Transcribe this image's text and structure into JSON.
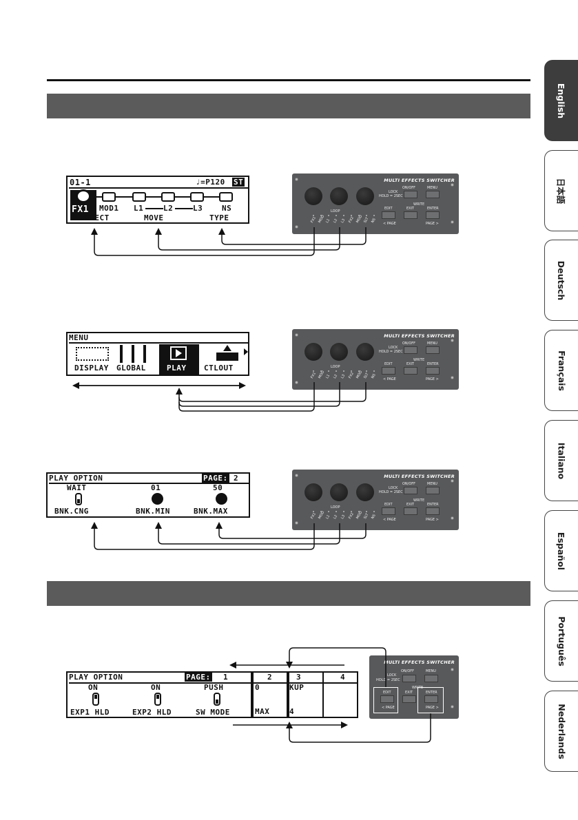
{
  "languages": [
    {
      "label": "English",
      "active": true
    },
    {
      "label": "日本語",
      "active": false
    },
    {
      "label": "Deutsch",
      "active": false
    },
    {
      "label": "Français",
      "active": false
    },
    {
      "label": "Italiano",
      "active": false
    },
    {
      "label": "Español",
      "active": false
    },
    {
      "label": "Português",
      "active": false
    },
    {
      "label": "Nederlands",
      "active": false
    }
  ],
  "panel": {
    "title": "MULTI EFFECTS SWITCHER",
    "on_off": "ON/OFF",
    "menu": "MENU",
    "lock": "LOCK",
    "hold_2sec": "HOLD = 2SEC",
    "write": "WRITE",
    "loop": "LOOP",
    "edit": "EDIT",
    "exit": "EXIT",
    "enter": "ENTER",
    "page_prev": "< PAGE",
    "page_next": "PAGE >",
    "knob_labels": [
      "FX1",
      "MOD",
      "L1",
      "L2",
      "L3",
      "FX2",
      "MOD",
      "SLT",
      "NS"
    ]
  },
  "screen1": {
    "patch": "01-1",
    "tempo": "♩=P120",
    "st": "ST",
    "blocks": [
      "FX1",
      "MOD1",
      "L1",
      "L2",
      "L3",
      "NS"
    ],
    "functions": [
      "SELECT",
      "MOVE",
      "TYPE"
    ]
  },
  "screen2": {
    "header": "MENU",
    "items": [
      "DISPLAY",
      "GLOBAL",
      "PLAY",
      "CTLOUT"
    ]
  },
  "screen3": {
    "header": "PLAY OPTION",
    "page_label": "PAGE:",
    "page_num": "2",
    "values": [
      "WAIT",
      "01",
      "50"
    ],
    "params": [
      "BNK.CNG",
      "BNK.MIN",
      "BNK.MAX"
    ]
  },
  "screen4": {
    "header": "PLAY OPTION",
    "page_label": "PAGE:",
    "page_num": "1",
    "values": [
      "ON",
      "ON",
      "PUSH"
    ],
    "params": [
      "EXP1 HLD",
      "EXP2 HLD",
      "SW MODE"
    ],
    "page2_num": "2",
    "page2_value": "0",
    "page2_param": "MAX",
    "page3_num": "3",
    "page3_value": "KUP",
    "page3_param": "4",
    "page4_num": "4"
  }
}
